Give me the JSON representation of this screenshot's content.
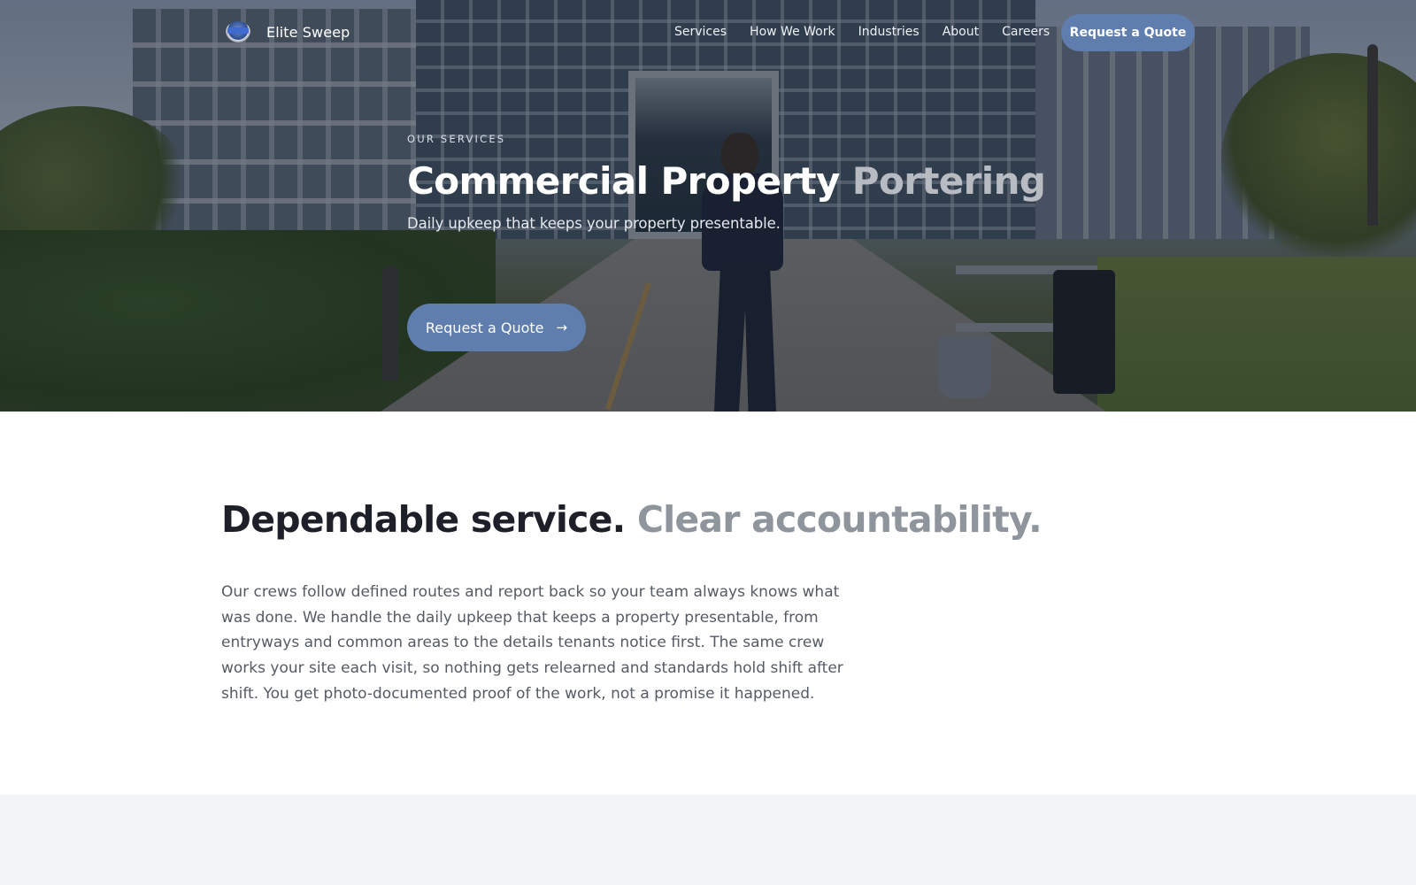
{
  "nav": {
    "brand": "Elite Sweep",
    "links": [
      "Services",
      "How We Work",
      "Industries",
      "About",
      "Careers"
    ],
    "cta": "Request a Quote"
  },
  "hero": {
    "eyebrow": "OUR SERVICES",
    "title_main": "Commercial Property",
    "title_accent": "Portering",
    "subtitle": "Daily upkeep that keeps your property presentable.",
    "cta": "Request a Quote",
    "cta_icon": "arrow-right-icon"
  },
  "section": {
    "title_main": "Dependable service.",
    "title_accent": "Clear accountability.",
    "body": "Our crews follow defined routes and report back so your team always knows what was done. We handle the daily upkeep that keeps a property presentable, from entryways and common areas to the details tenants notice first. The same crew works your site each visit, so nothing gets relearned and standards hold shift after shift. You get photo-documented proof of the work, not a promise it happened."
  },
  "colors": {
    "accent": "#5f7eae",
    "heading": "#1d2028",
    "heading_muted": "#8f959d",
    "body_text": "#555b64",
    "band": "#f3f4f6"
  }
}
